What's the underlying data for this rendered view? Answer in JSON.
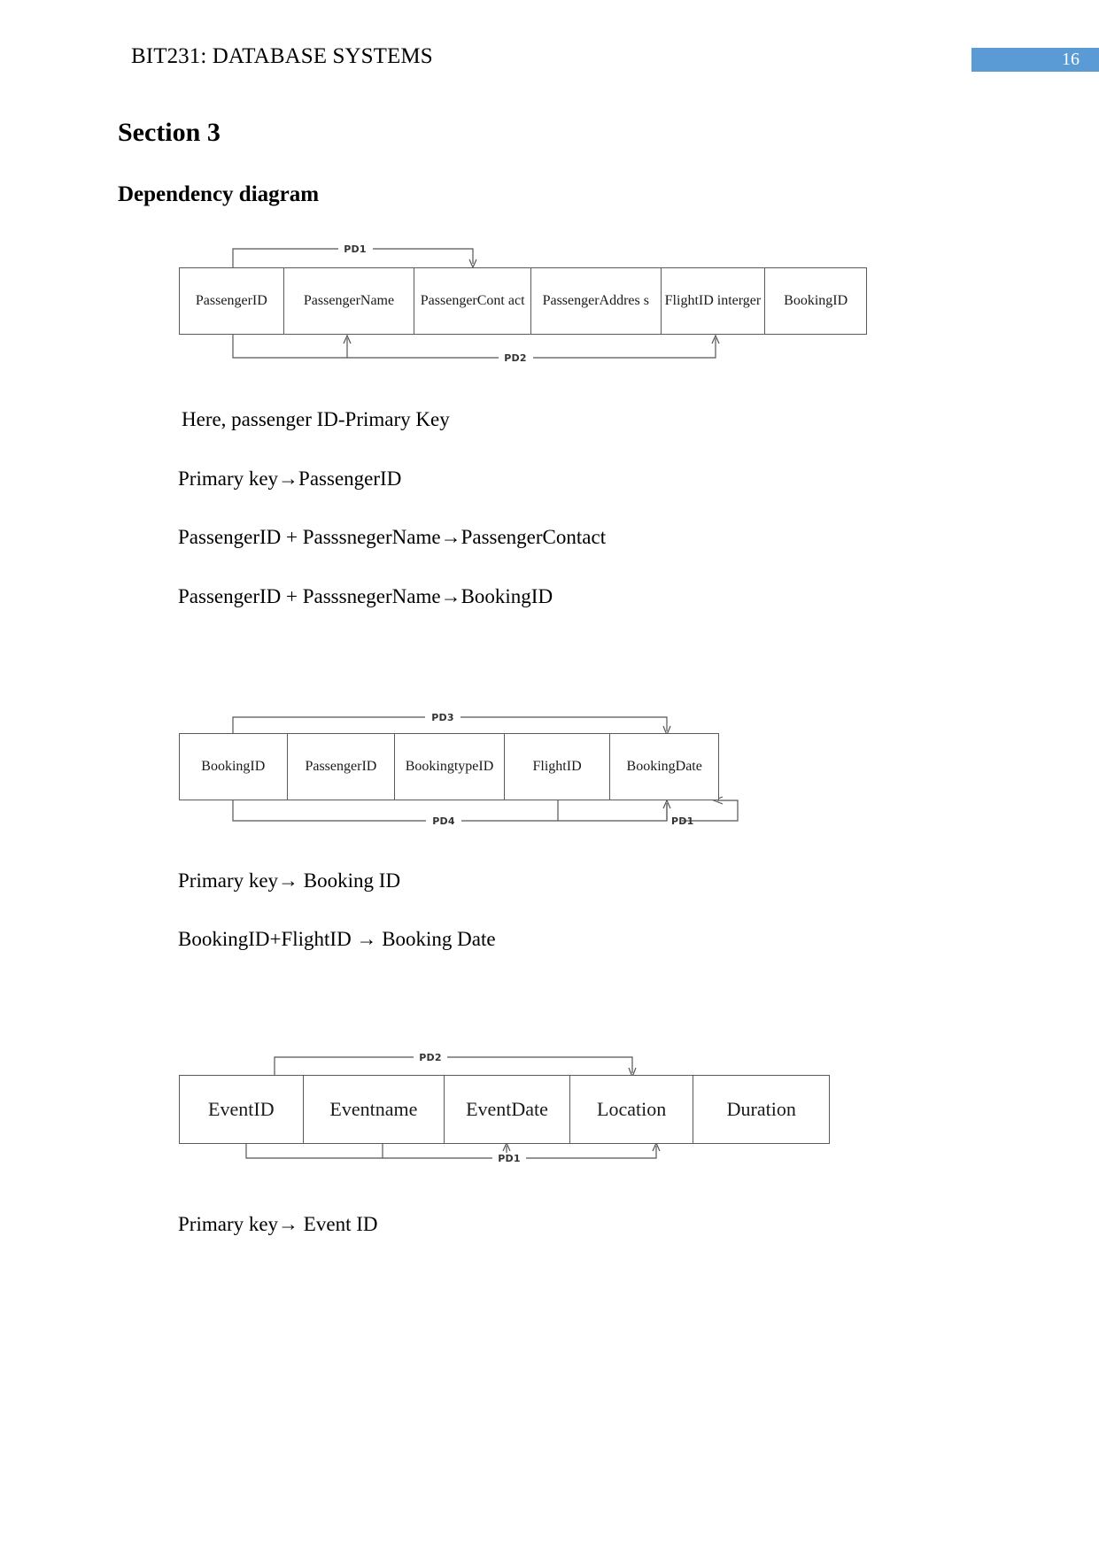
{
  "header": {
    "title": "BIT231: DATABASE SYSTEMS",
    "page_number": "16",
    "page_number_color": "#5B9BD5"
  },
  "headings": {
    "section": "Section 3",
    "subtitle": "Dependency diagram"
  },
  "diagram1": {
    "columns": [
      "PassengerID",
      "PassengerName",
      "PassengerCont act",
      "PassengerAddres s",
      "FlightID interger",
      "BookingID"
    ],
    "dependencies": [
      {
        "label": "PD1",
        "position": "above"
      },
      {
        "label": "PD2",
        "position": "below"
      }
    ]
  },
  "notes1": [
    "Here, passenger ID-Primary Key",
    "Primary key→PassengerID",
    "PassengerID + PasssnegerName→PassengerContact",
    "PassengerID + PasssnegerName→BookingID"
  ],
  "diagram2": {
    "columns": [
      "BookingID",
      "PassengerID",
      "BookingtypeID",
      "FlightID",
      "BookingDate"
    ],
    "dependencies": [
      {
        "label": "PD3",
        "position": "above"
      },
      {
        "label": "PD4",
        "position": "below"
      },
      {
        "label": "PD1",
        "position": "below"
      }
    ]
  },
  "notes2": [
    "Primary key→ Booking ID",
    "BookingID+FlightID → Booking Date"
  ],
  "diagram3": {
    "columns": [
      "EventID",
      "Eventname",
      "EventDate",
      "Location",
      "Duration"
    ],
    "dependencies": [
      {
        "label": "PD2",
        "position": "above"
      },
      {
        "label": "PD1",
        "position": "below"
      }
    ]
  },
  "notes3": [
    "Primary key→ Event ID"
  ]
}
